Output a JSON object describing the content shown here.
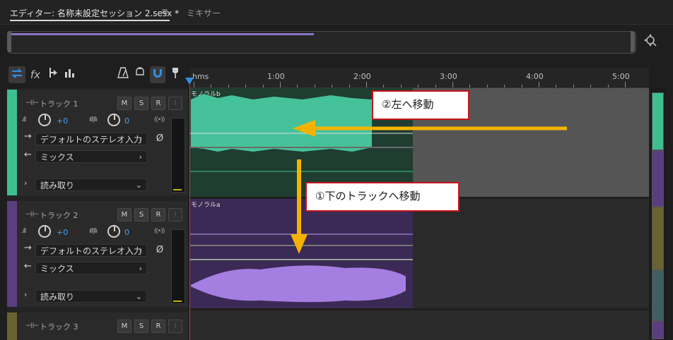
{
  "tabs": {
    "editor_label": "エディター: 名称未設定セッション 2.sesx *",
    "menu_glyph": "≡",
    "mixer_label": "ミキサー"
  },
  "toolbar": {
    "icons": [
      "swap-arrows-icon",
      "fx-icon",
      "sends-icon",
      "eq-icon",
      "metronome-icon",
      "loop-icon",
      "snap-magnet-icon",
      "marker-icon"
    ],
    "fx_label": "fx"
  },
  "ruler": {
    "labels": [
      "hms",
      "1:00",
      "2:00",
      "3:00",
      "4:00",
      "5:00"
    ]
  },
  "tracks": [
    {
      "name": "トラック 1",
      "color": "#3fbf90",
      "mute": "M",
      "solo": "S",
      "record": "R",
      "input_monitor": "I",
      "volume": "+0",
      "pan": "0",
      "input": "デフォルトのステレオ入力",
      "output": "ミックス",
      "automation": "読み取り",
      "clip_label": "モノラルb"
    },
    {
      "name": "トラック 2",
      "color": "#5a3f80",
      "mute": "M",
      "solo": "S",
      "record": "R",
      "input_monitor": "I",
      "volume": "+0",
      "pan": "0",
      "input": "デフォルトのステレオ入力",
      "output": "ミックス",
      "automation": "読み取り",
      "clip_label": "モノラルa"
    },
    {
      "name": "トラック 3",
      "color": "#6a6230",
      "mute": "M",
      "solo": "S",
      "record": "R",
      "input_monitor": "I"
    }
  ],
  "annotations": {
    "move_left": "②左へ移動",
    "move_down": "①下のトラックへ移動",
    "arrow_color": "#f5b300",
    "callout_border": "#c4151c"
  }
}
